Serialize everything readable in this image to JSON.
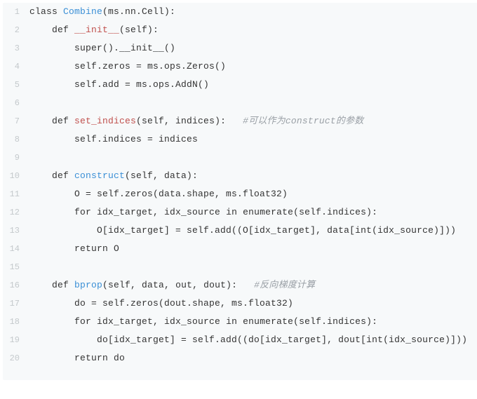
{
  "code": {
    "lines": [
      {
        "n": "1",
        "tokens": [
          {
            "c": "tk-kw",
            "t": "class "
          },
          {
            "c": "tk-cls",
            "t": "Combine"
          },
          {
            "c": "tk-punc",
            "t": "(ms.nn.Cell):"
          }
        ]
      },
      {
        "n": "2",
        "tokens": [
          {
            "c": "tk-txt",
            "t": "    "
          },
          {
            "c": "tk-kw",
            "t": "def "
          },
          {
            "c": "tk-dunder",
            "t": "__init__"
          },
          {
            "c": "tk-punc",
            "t": "(self):"
          }
        ]
      },
      {
        "n": "3",
        "tokens": [
          {
            "c": "tk-txt",
            "t": "        super().__init__()"
          }
        ]
      },
      {
        "n": "4",
        "tokens": [
          {
            "c": "tk-txt",
            "t": "        self.zeros = ms.ops.Zeros()"
          }
        ]
      },
      {
        "n": "5",
        "tokens": [
          {
            "c": "tk-txt",
            "t": "        self.add = ms.ops.AddN()"
          }
        ]
      },
      {
        "n": "6",
        "tokens": []
      },
      {
        "n": "7",
        "tokens": [
          {
            "c": "tk-txt",
            "t": "    "
          },
          {
            "c": "tk-kw",
            "t": "def "
          },
          {
            "c": "tk-dunder",
            "t": "set_indices"
          },
          {
            "c": "tk-punc",
            "t": "(self, indices):   "
          },
          {
            "c": "tk-cmt",
            "t": "#可以作为construct的参数"
          }
        ]
      },
      {
        "n": "8",
        "tokens": [
          {
            "c": "tk-txt",
            "t": "        self.indices = indices"
          }
        ]
      },
      {
        "n": "9",
        "tokens": []
      },
      {
        "n": "10",
        "tokens": [
          {
            "c": "tk-txt",
            "t": "    "
          },
          {
            "c": "tk-kw",
            "t": "def "
          },
          {
            "c": "tk-def",
            "t": "construct"
          },
          {
            "c": "tk-punc",
            "t": "(self, data):"
          }
        ]
      },
      {
        "n": "11",
        "tokens": [
          {
            "c": "tk-txt",
            "t": "        O = self.zeros(data.shape, ms.float32)"
          }
        ]
      },
      {
        "n": "12",
        "tokens": [
          {
            "c": "tk-txt",
            "t": "        "
          },
          {
            "c": "tk-kw",
            "t": "for"
          },
          {
            "c": "tk-txt",
            "t": " idx_target, idx_source "
          },
          {
            "c": "tk-kw",
            "t": "in"
          },
          {
            "c": "tk-txt",
            "t": " enumerate(self.indices):"
          }
        ]
      },
      {
        "n": "13",
        "tokens": [
          {
            "c": "tk-txt",
            "t": "            O[idx_target] = self.add((O[idx_target], data[int(idx_source)]))"
          }
        ]
      },
      {
        "n": "14",
        "tokens": [
          {
            "c": "tk-txt",
            "t": "        "
          },
          {
            "c": "tk-kw",
            "t": "return"
          },
          {
            "c": "tk-txt",
            "t": " O"
          }
        ]
      },
      {
        "n": "15",
        "tokens": []
      },
      {
        "n": "16",
        "tokens": [
          {
            "c": "tk-txt",
            "t": "    "
          },
          {
            "c": "tk-kw",
            "t": "def "
          },
          {
            "c": "tk-def",
            "t": "bprop"
          },
          {
            "c": "tk-punc",
            "t": "(self, data, out, dout):   "
          },
          {
            "c": "tk-cmt",
            "t": "#反向梯度计算"
          }
        ]
      },
      {
        "n": "17",
        "tokens": [
          {
            "c": "tk-txt",
            "t": "        do = self.zeros(dout.shape, ms.float32)"
          }
        ]
      },
      {
        "n": "18",
        "tokens": [
          {
            "c": "tk-txt",
            "t": "        "
          },
          {
            "c": "tk-kw",
            "t": "for"
          },
          {
            "c": "tk-txt",
            "t": " idx_target, idx_source "
          },
          {
            "c": "tk-kw",
            "t": "in"
          },
          {
            "c": "tk-txt",
            "t": " enumerate(self.indices):"
          }
        ]
      },
      {
        "n": "19",
        "tokens": [
          {
            "c": "tk-txt",
            "t": "            do[idx_target] = self.add((do[idx_target], dout[int(idx_source)]))"
          }
        ]
      },
      {
        "n": "20",
        "tokens": [
          {
            "c": "tk-txt",
            "t": "        "
          },
          {
            "c": "tk-kw",
            "t": "return"
          },
          {
            "c": "tk-txt",
            "t": " do"
          }
        ]
      }
    ]
  }
}
